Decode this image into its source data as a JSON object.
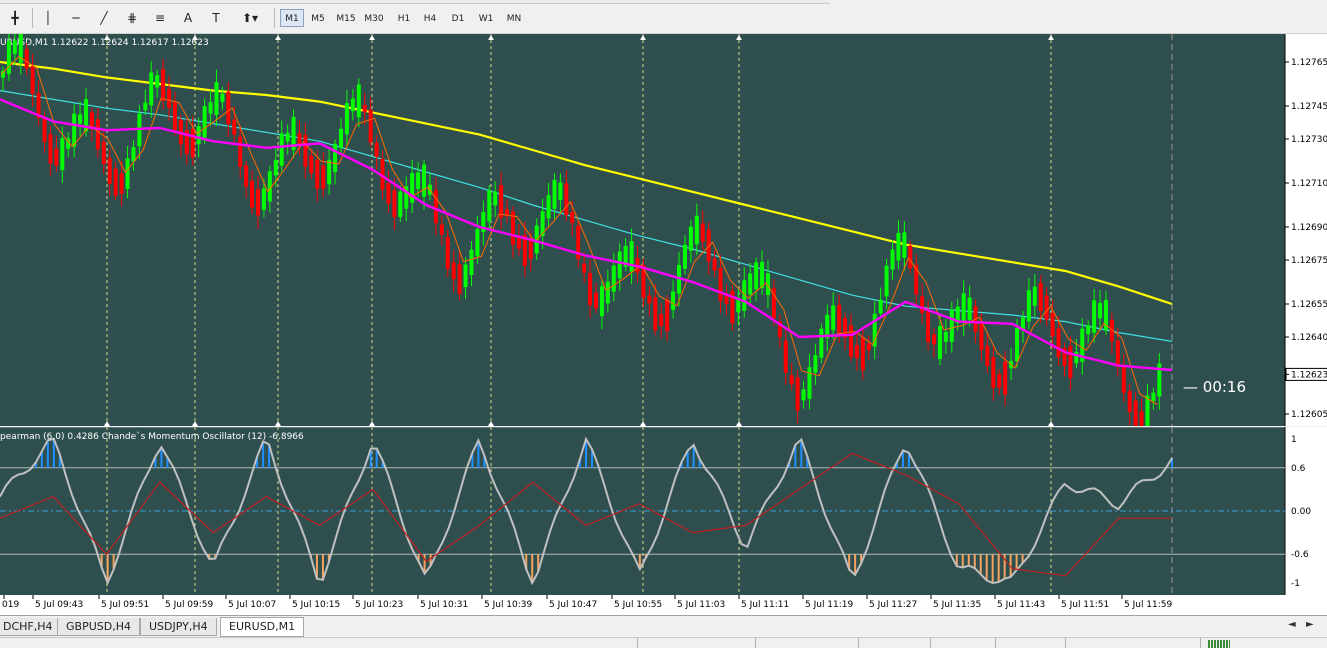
{
  "toolbar": {
    "timeframes": [
      "M1",
      "M5",
      "M15",
      "M30",
      "H1",
      "H4",
      "D1",
      "W1",
      "MN"
    ],
    "active_timeframe": "M1"
  },
  "chart": {
    "symbol_label": "URUSD,M1  1.12622 1.12624 1.12617 1.12623",
    "countdown": "00:16",
    "current_price_label": "1.12623",
    "indicator_label": "pearman (6,0) 0.4286  Chande`s Momentum Oscillator (12) -6.8966",
    "colors": {
      "background": "#2f4f4f",
      "bull": "#00ff00",
      "bear": "#ff0000",
      "ma_slow": "#ffff00",
      "ma_mid": "#40e0e0",
      "ma_fast": "#ff00ff",
      "ma_thin": "#ff6a00",
      "osc_spearman": "#c0c0c0",
      "osc_cmo": "#c02020",
      "hist_high": "#1e90ff",
      "hist_low": "#f4a460"
    }
  },
  "chart_data": [
    {
      "type": "candlestick",
      "title": "URUSD,M1",
      "ylim": [
        1.126,
        1.12775
      ],
      "y_ticks": [
        "1.12765",
        "1.12745",
        "1.12730",
        "1.12710",
        "1.12690",
        "1.12675",
        "1.12655",
        "1.12640",
        "1.12623",
        "1.12605"
      ],
      "x_ticks": [
        "019",
        "5 Jul 09:43",
        "5 Jul 09:51",
        "5 Jul 09:59",
        "5 Jul 10:07",
        "5 Jul 10:15",
        "5 Jul 10:23",
        "5 Jul 10:31",
        "5 Jul 10:39",
        "5 Jul 10:47",
        "5 Jul 10:55",
        "5 Jul 11:03",
        "5 Jul 11:11",
        "5 Jul 11:19",
        "5 Jul 11:27",
        "5 Jul 11:35",
        "5 Jul 11:43",
        "5 Jul 11:51",
        "5 Jul 11:59"
      ],
      "series": [
        {
          "name": "ma_slow",
          "values": [
            1.12765,
            1.12762,
            1.12758,
            1.12755,
            1.12752,
            1.1275,
            1.12747,
            1.12742,
            1.12737,
            1.12732,
            1.12725,
            1.12718,
            1.12712,
            1.12706,
            1.127,
            1.12694,
            1.12688,
            1.12682,
            1.12678,
            1.12674,
            1.1267,
            1.12663,
            1.12655
          ]
        },
        {
          "name": "ma_mid",
          "values": [
            1.12752,
            1.12748,
            1.12744,
            1.12741,
            1.12737,
            1.12733,
            1.12729,
            1.12722,
            1.12715,
            1.12708,
            1.127,
            1.12693,
            1.12686,
            1.1268,
            1.12673,
            1.12666,
            1.12659,
            1.12654,
            1.12652,
            1.1265,
            1.12647,
            1.12642,
            1.12638
          ]
        },
        {
          "name": "ma_fast",
          "values": [
            1.12748,
            1.12738,
            1.12734,
            1.12735,
            1.12729,
            1.12726,
            1.12728,
            1.12716,
            1.127,
            1.1269,
            1.12684,
            1.12677,
            1.12672,
            1.12665,
            1.12656,
            1.1264,
            1.12641,
            1.12656,
            1.12647,
            1.12646,
            1.12633,
            1.12627,
            1.12625
          ]
        },
        {
          "name": "spearman",
          "values": [
            0.2,
            1,
            -1,
            1,
            -0.8,
            1,
            -1,
            1,
            -1,
            1,
            -1,
            1,
            -0.9,
            1,
            -0.5,
            1,
            -1,
            1,
            -0.8,
            -1,
            0.4,
            0.1,
            0.7
          ]
        },
        {
          "name": "cmo",
          "values": [
            -0.1,
            0.2,
            -0.6,
            0.4,
            -0.3,
            0.2,
            -0.2,
            0.3,
            -0.7,
            -0.2,
            0.4,
            -0.2,
            0.1,
            -0.3,
            -0.2,
            0.3,
            0.8,
            0.5,
            0.1,
            -0.8,
            -0.9,
            -0.1,
            -0.1
          ]
        }
      ]
    },
    {
      "type": "line",
      "title": "pearman (6,0) 0.4286  Chande`s Momentum Oscillator (12) -6.8966",
      "ylim": [
        -1,
        1
      ],
      "y_ticks": [
        "1",
        "0.6",
        "0.00",
        "-0.6",
        "-1"
      ],
      "levels": [
        0.6,
        0,
        -0.6
      ]
    }
  ],
  "tabs": [
    "DCHF,H4",
    "GBPUSD,H4",
    "USDJPY,H4",
    "EURUSD,M1"
  ],
  "active_tab": "EURUSD,M1"
}
